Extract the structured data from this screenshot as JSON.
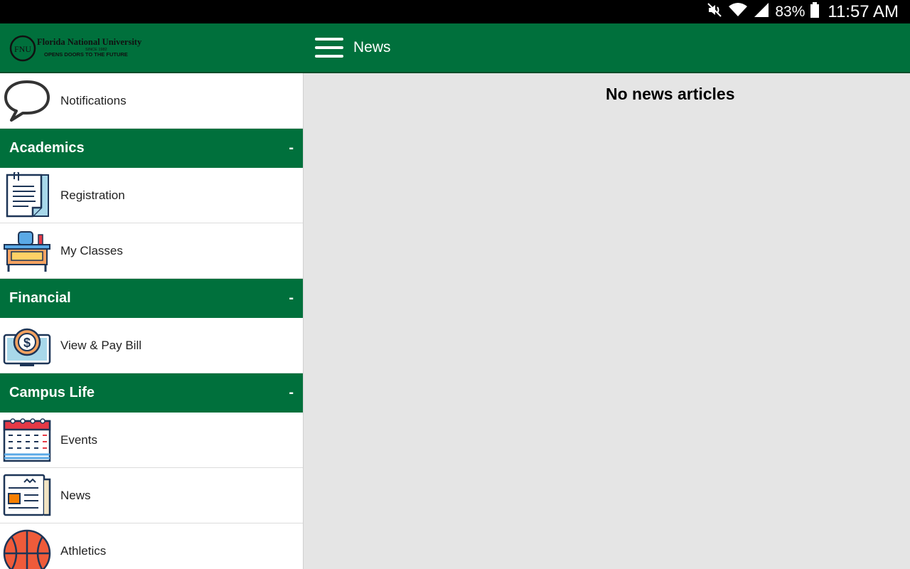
{
  "status_bar": {
    "battery_percent": "83%",
    "time": "11:57 AM",
    "icons": [
      "mute-icon",
      "wifi-icon",
      "signal-icon",
      "battery-icon"
    ]
  },
  "app_bar": {
    "logo": {
      "name": "Florida National University",
      "since": "SINCE 1982",
      "tagline": "OPENS DOORS TO THE FUTURE",
      "monogram": "FNU"
    },
    "title": "News",
    "menu_icon": "hamburger-menu-icon"
  },
  "drawer": {
    "notifications": {
      "label": "Notifications",
      "icon": "speech-bubble-icon"
    },
    "sections": [
      {
        "title": "Academics",
        "toggle": "-",
        "items": [
          {
            "label": "Registration",
            "icon": "document-icon"
          },
          {
            "label": "My Classes",
            "icon": "desk-icon"
          }
        ]
      },
      {
        "title": "Financial",
        "toggle": "-",
        "items": [
          {
            "label": "View & Pay Bill",
            "icon": "dollar-monitor-icon"
          }
        ]
      },
      {
        "title": "Campus Life",
        "toggle": "-",
        "items": [
          {
            "label": "Events",
            "icon": "calendar-icon"
          },
          {
            "label": "News",
            "icon": "newspaper-icon"
          },
          {
            "label": "Athletics",
            "icon": "basketball-icon"
          }
        ]
      }
    ]
  },
  "content": {
    "empty_message": "No news articles"
  },
  "colors": {
    "primary_green": "#00703c",
    "content_bg": "#e5e5e5",
    "status_bar_bg": "#000000"
  }
}
